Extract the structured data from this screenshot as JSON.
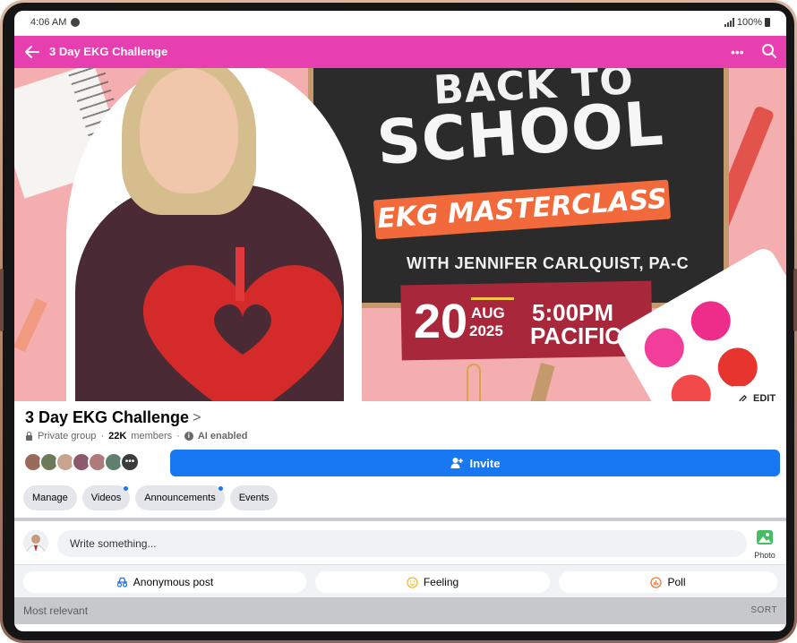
{
  "status_bar": {
    "time": "4:06 AM",
    "battery": "100%"
  },
  "app_bar": {
    "title": "3 Day EKG Challenge",
    "more_icon": "more-horizontal-icon",
    "search_icon": "search-icon"
  },
  "cover": {
    "headline_top": "BACK TO",
    "headline_main": "SCHOOL",
    "ribbon": "EKG MASTERCLASS",
    "with_line": "WITH JENNIFER CARLQUIST, PA-C",
    "day": "20",
    "month": "AUG",
    "year": "2025",
    "time_1": "5:00PM",
    "time_2": "PACIFIC",
    "edit_label": "EDIT"
  },
  "group": {
    "name": "3 Day EKG Challenge",
    "chevron": ">",
    "privacy": "Private group",
    "members_count": "22K",
    "members_label": "members",
    "ai_label": "AI enabled"
  },
  "invite_label": "Invite",
  "tabs": [
    {
      "label": "Manage",
      "dot": false
    },
    {
      "label": "Videos",
      "dot": true
    },
    {
      "label": "Announcements",
      "dot": true
    },
    {
      "label": "Events",
      "dot": false
    }
  ],
  "composer": {
    "placeholder": "Write something...",
    "photo_label": "Photo"
  },
  "actions": [
    {
      "label": "Anonymous post",
      "icon": "anonymous-icon"
    },
    {
      "label": "Feeling",
      "icon": "smile-icon"
    },
    {
      "label": "Poll",
      "icon": "poll-icon"
    }
  ],
  "sort": {
    "left": "Most relevant",
    "right": "SORT"
  },
  "colors": {
    "app_bar": "#e83fb0",
    "primary": "#1877f2"
  }
}
